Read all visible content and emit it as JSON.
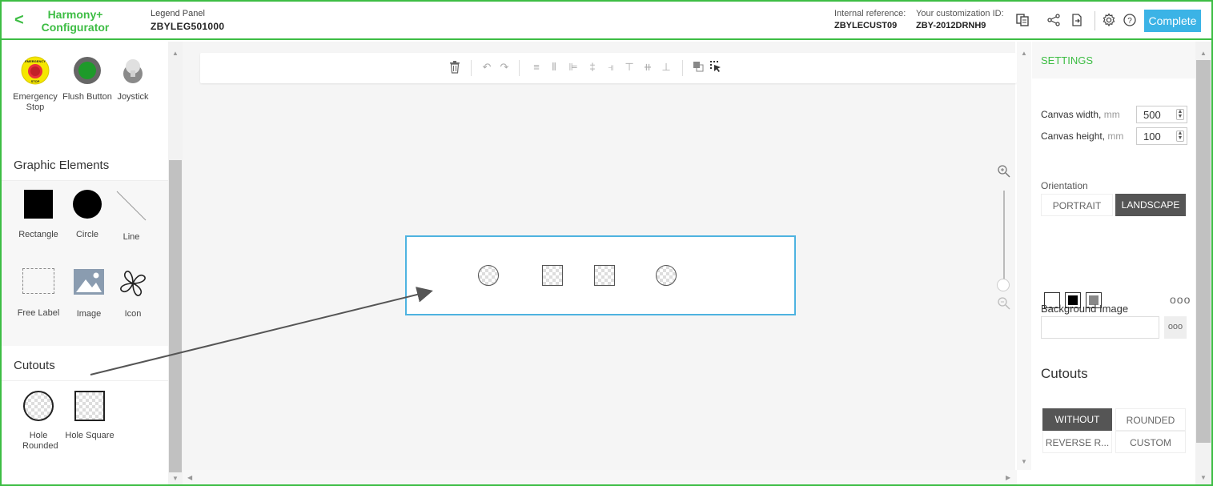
{
  "header": {
    "back_icon": "chevron-left",
    "brand_line1": "Harmony+",
    "brand_line2": "Configurator",
    "product_label": "Legend Panel",
    "product_code": "ZBYLEG501000",
    "internal_ref_label": "Internal reference:",
    "internal_ref_value": "ZBYLECUST09",
    "custom_id_label": "Your customization ID:",
    "custom_id_value": "ZBY-2012DRNH9",
    "complete_label": "Complete",
    "brand_color": "#3dbd44",
    "accent_color": "#3bb3e6"
  },
  "library": {
    "items_top": [
      {
        "label": "Emergency Stop"
      },
      {
        "label": "Flush Button"
      },
      {
        "label": "Joystick"
      }
    ],
    "emergency_ring_text": "EMERGENCY",
    "emergency_stop_text": "STOP",
    "graphic_heading": "Graphic Elements",
    "graphic_items": [
      {
        "label": "Rectangle"
      },
      {
        "label": "Circle"
      },
      {
        "label": "Line"
      },
      {
        "label": "Free Label"
      },
      {
        "label": "Image"
      },
      {
        "label": "Icon"
      }
    ],
    "cutouts_heading": "Cutouts",
    "cutout_items": [
      {
        "label": "Hole Rounded"
      },
      {
        "label": "Hole Square"
      }
    ]
  },
  "settings": {
    "title": "SETTINGS",
    "canvas_width_label": "Canvas width,",
    "canvas_height_label": "Canvas height,",
    "unit": "mm",
    "canvas_width": "500",
    "canvas_height": "100",
    "orientation_label": "Orientation",
    "orientation_options": [
      "PORTRAIT",
      "LANDSCAPE"
    ],
    "orientation_selected": "LANDSCAPE",
    "more_label": "ooo",
    "background_image_label": "Background Image",
    "background_image_value": "",
    "cutouts_heading": "Cutouts",
    "cutout_options": [
      "WITHOUT",
      "ROUNDED",
      "REVERSE R...",
      "CUSTOM"
    ],
    "cutout_selected": "WITHOUT"
  }
}
